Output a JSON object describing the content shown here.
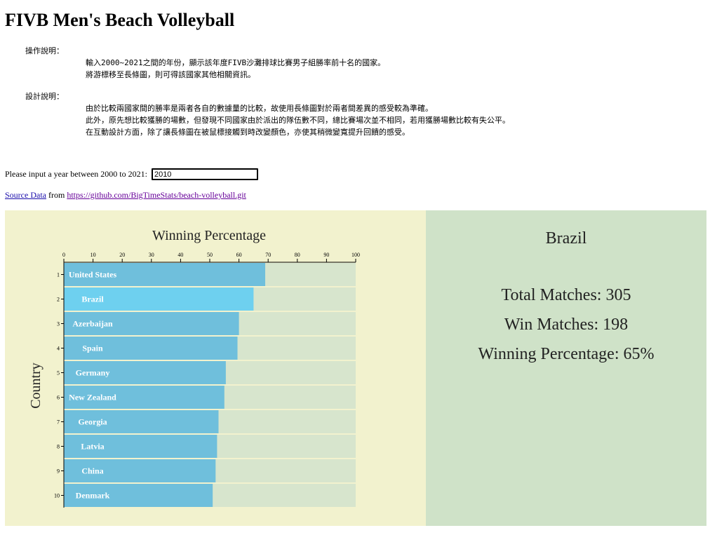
{
  "page": {
    "title": "FIVB Men's Beach Volleyball"
  },
  "notes": {
    "operation": {
      "heading": "操作說明：",
      "lines": [
        "輸入2000~2021之間的年份，顯示該年度FIVB沙灘排球比賽男子組勝率前十名的國家。",
        "將游標移至長條圖，則可得該國家其他相關資訊。"
      ]
    },
    "design": {
      "heading": "設計說明：",
      "lines": [
        "由於比較兩國家間的勝率是兩者各自的數據量的比較，故使用長條圖對於兩者間差異的感受較為準確。",
        "此外，原先想比較獲勝的場數，但發現不同國家由於派出的隊伍數不同，總比賽場次並不相同，若用獲勝場數比較有失公平。",
        "在互動設計方面，除了讓長條圖在被鼠標接觸到時改變顏色，亦使其稍微變寬提升回饋的感受。"
      ]
    }
  },
  "year_input": {
    "label": "Please input a year between 2000 to 2021:",
    "value": "2010"
  },
  "source": {
    "link_text": "Source Data",
    "middle_text": "from",
    "url_text": "https://github.com/BigTimeStats/beach-volleyball.git"
  },
  "info": {
    "country": "Brazil",
    "total_matches": "Total Matches: 305",
    "win_matches": "Win Matches: 198",
    "winning_percentage": "Winning Percentage: 65%"
  },
  "chart_data": {
    "type": "bar",
    "orientation": "horizontal",
    "title": "Winning Percentage",
    "xlabel": "",
    "ylabel": "Country",
    "xlim": [
      0,
      100
    ],
    "xticks": [
      0,
      10,
      20,
      30,
      40,
      50,
      60,
      70,
      80,
      90,
      100
    ],
    "ranks": [
      1,
      2,
      3,
      4,
      5,
      6,
      7,
      8,
      9,
      10
    ],
    "categories": [
      "United States",
      "Brazil",
      "Azerbaijan",
      "Spain",
      "Germany",
      "New Zealand",
      "Georgia",
      "Latvia",
      "China",
      "Denmark"
    ],
    "values": [
      69,
      65,
      60,
      59.5,
      55.5,
      55,
      53,
      52.5,
      52,
      51
    ],
    "highlighted": "Brazil",
    "colors": {
      "bar": "#6fbfdc",
      "bar_highlight": "#6ed0ef",
      "track": "#d7e5cd",
      "label": "#ffffff"
    }
  }
}
